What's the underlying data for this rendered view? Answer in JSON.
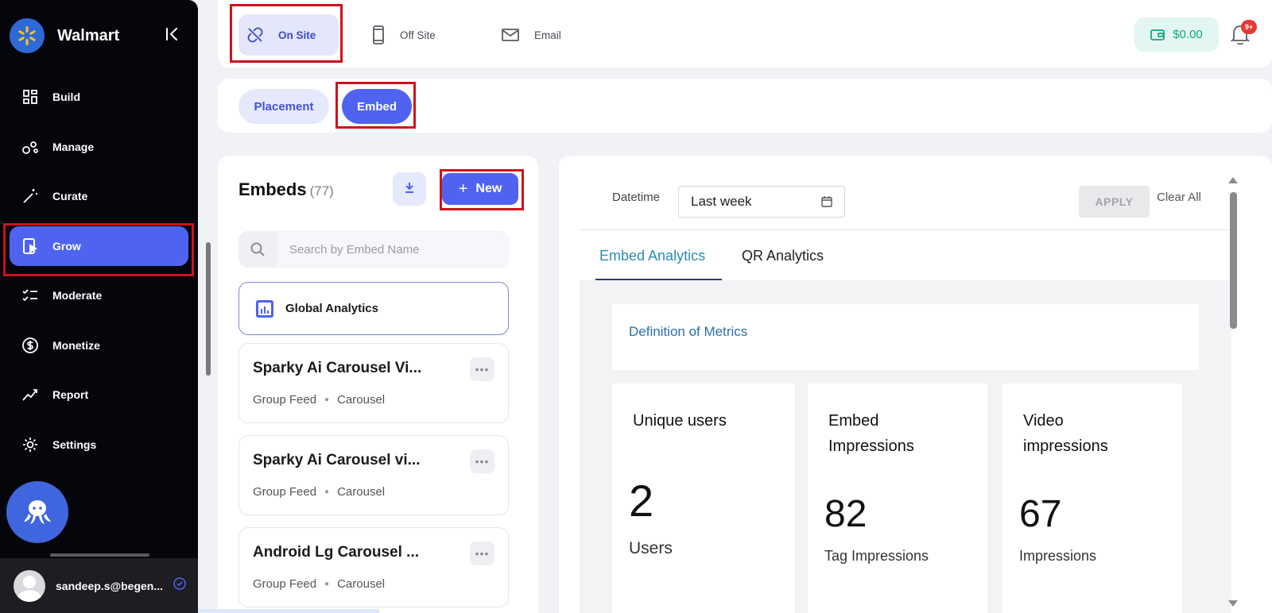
{
  "sidebar": {
    "brand_name": "Walmart",
    "nav": [
      {
        "label": "Build",
        "icon": "grid-icon"
      },
      {
        "label": "Manage",
        "icon": "nodes-icon"
      },
      {
        "label": "Curate",
        "icon": "magic-wand-icon"
      },
      {
        "label": "Grow",
        "icon": "play-device-icon",
        "active": true
      },
      {
        "label": "Moderate",
        "icon": "checklist-icon"
      },
      {
        "label": "Monetize",
        "icon": "dollar-circle-icon"
      },
      {
        "label": "Report",
        "icon": "trend-icon"
      },
      {
        "label": "Settings",
        "icon": "gear-icon"
      }
    ],
    "user_email": "sandeep.s@begen..."
  },
  "topbar": {
    "channels": [
      {
        "label": "On Site",
        "icon": "link-off-icon",
        "active": true
      },
      {
        "label": "Off Site",
        "icon": "phone-icon"
      },
      {
        "label": "Email",
        "icon": "mail-icon"
      }
    ],
    "wallet_amount": "$0.00",
    "notification_badge": "9+"
  },
  "subtabs": {
    "placement": "Placement",
    "embed": "Embed"
  },
  "embeds": {
    "title": "Embeds",
    "count": "(77)",
    "new_label": "New",
    "search_placeholder": "Search by Embed Name",
    "global_analytics": "Global Analytics",
    "items": [
      {
        "title": "Sparky Ai Carousel Vi...",
        "type": "Group Feed",
        "layout": "Carousel"
      },
      {
        "title": "Sparky Ai Carousel vi...",
        "type": "Group Feed",
        "layout": "Carousel"
      },
      {
        "title": "Android Lg Carousel ...",
        "type": "Group Feed",
        "layout": "Carousel"
      }
    ]
  },
  "analytics": {
    "filter_label": "Datetime",
    "date_value": "Last week",
    "apply_label": "APPLY",
    "clear_label": "Clear All",
    "tabs": [
      "Embed Analytics",
      "QR Analytics"
    ],
    "definition_link": "Definition of Metrics",
    "metrics": [
      {
        "title": "Unique users",
        "value": "2",
        "unit": "Users"
      },
      {
        "title": "Embed Impressions",
        "value": "82",
        "unit": "Tag Impressions"
      },
      {
        "title": "Video impressions",
        "value": "67",
        "unit": "Impressions"
      }
    ]
  },
  "colors": {
    "accent": "#4f63f0",
    "sidebar_bg": "#05060b",
    "highlight_frame": "#d0101a",
    "wallet_green": "#10a884"
  }
}
